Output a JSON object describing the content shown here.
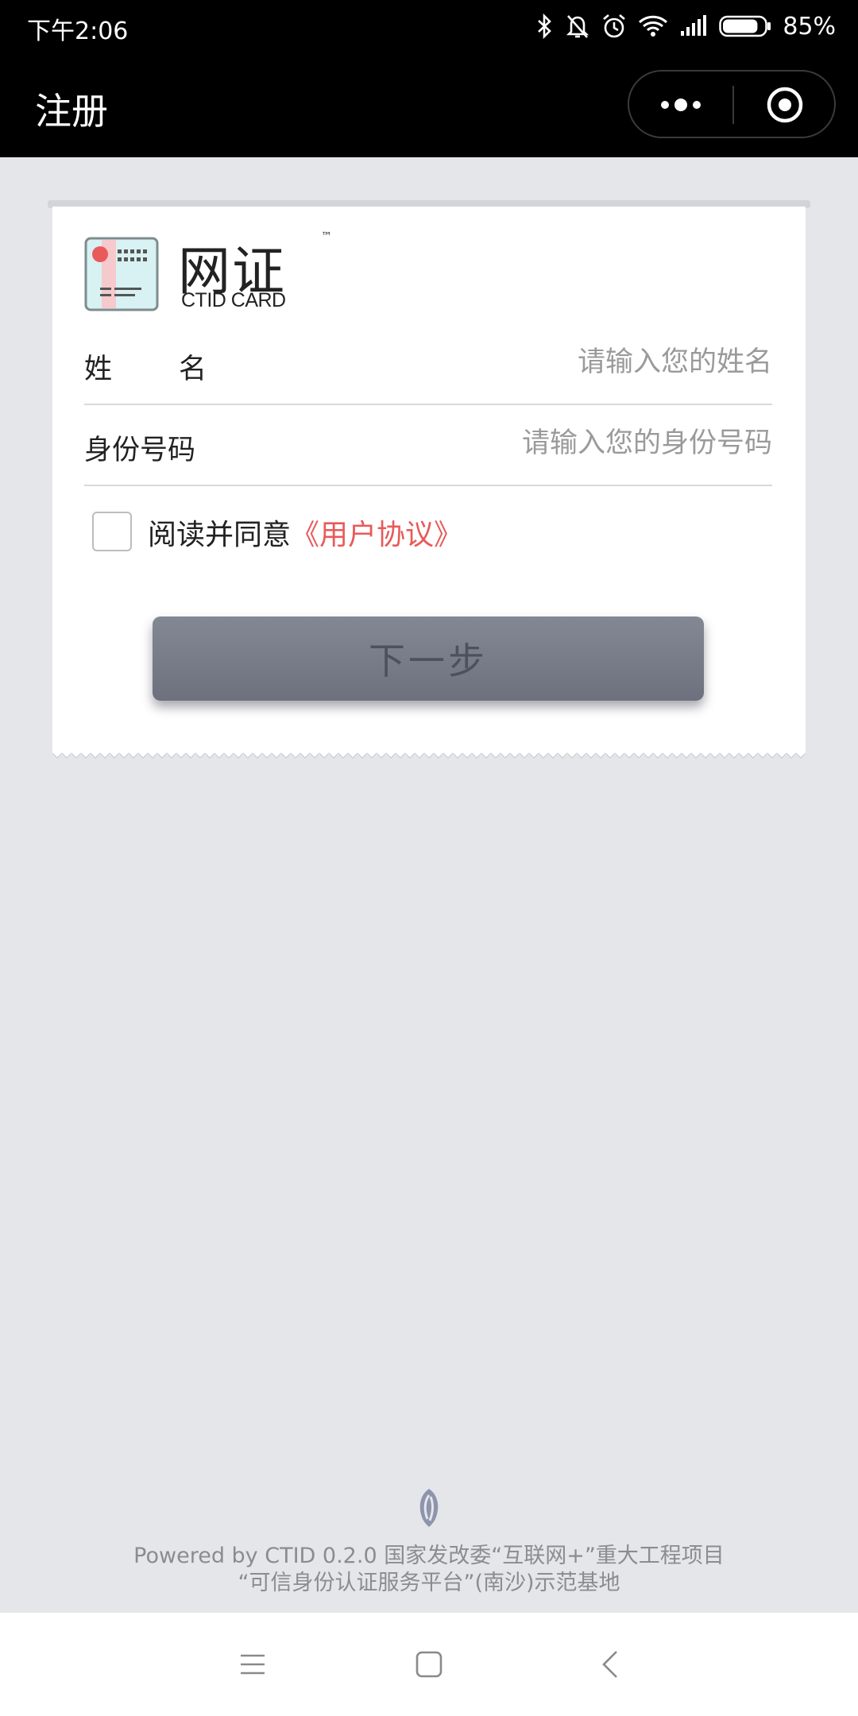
{
  "status_bar": {
    "time": "下午2:06",
    "battery_percent": "85%",
    "battery_level": 0.85,
    "icons": [
      "bluetooth-icon",
      "mute-icon",
      "alarm-icon",
      "wifi-icon",
      "signal-icon",
      "battery-icon"
    ]
  },
  "title_bar": {
    "title": "注册",
    "more_icon": "more-dots-icon",
    "close_icon": "close-target-icon"
  },
  "logo": {
    "title": "网证",
    "tm": "™",
    "subtitle": "CTID CARD"
  },
  "form": {
    "name_label": "姓名",
    "name_placeholder": "请输入您的姓名",
    "id_label": "身份号码",
    "id_placeholder": "请输入您的身份号码"
  },
  "agreement": {
    "checked": false,
    "text": "阅读并同意",
    "link": "《用户协议》"
  },
  "next_button": {
    "label": "下一步"
  },
  "footer": {
    "line1": "Powered by CTID 0.2.0 国家发改委“互联网+”重大工程项目",
    "line2": "“可信身份认证服务平台”(南沙)示范基地"
  },
  "nav_bar": {
    "icons": [
      "menu-icon",
      "home-icon",
      "back-icon"
    ]
  },
  "colors": {
    "status_bg": "#000000",
    "page_bg": "#e4e6ea",
    "link_red": "#e85a5a",
    "button_bg": "#777b87",
    "placeholder": "#9a9a9a"
  }
}
